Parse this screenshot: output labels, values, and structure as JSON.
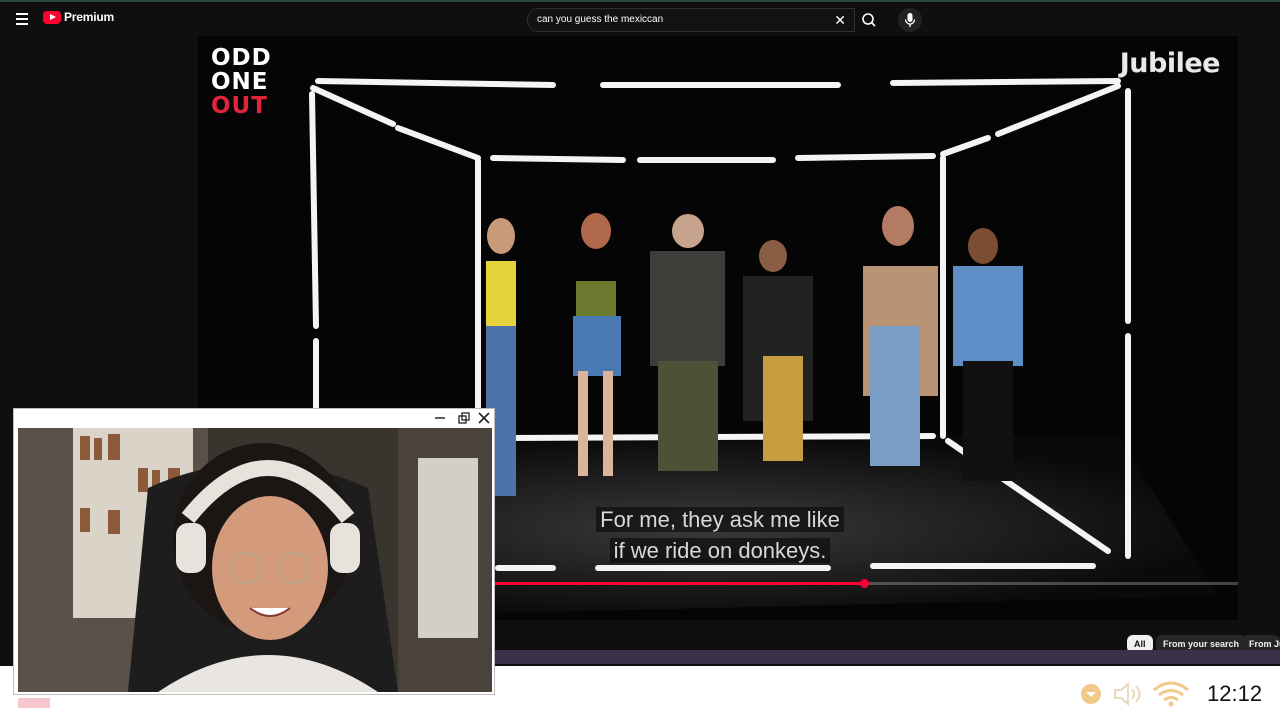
{
  "app": {
    "logo_label": "Premium"
  },
  "search": {
    "value": "can you guess the mexiccan"
  },
  "video": {
    "brand_left": [
      "ODD",
      "ONE",
      "OUT"
    ],
    "brand_right": "Jubilee",
    "caption": [
      "For me, they ask me like",
      "if we ride on donkeys."
    ],
    "progress_fraction": 0.64
  },
  "chips": [
    "All",
    "From your search",
    "From Jubilee"
  ],
  "taskbar": {
    "clock": "12:12"
  },
  "colors": {
    "accent": "#ff0033",
    "brand_red": "#e0253a"
  }
}
